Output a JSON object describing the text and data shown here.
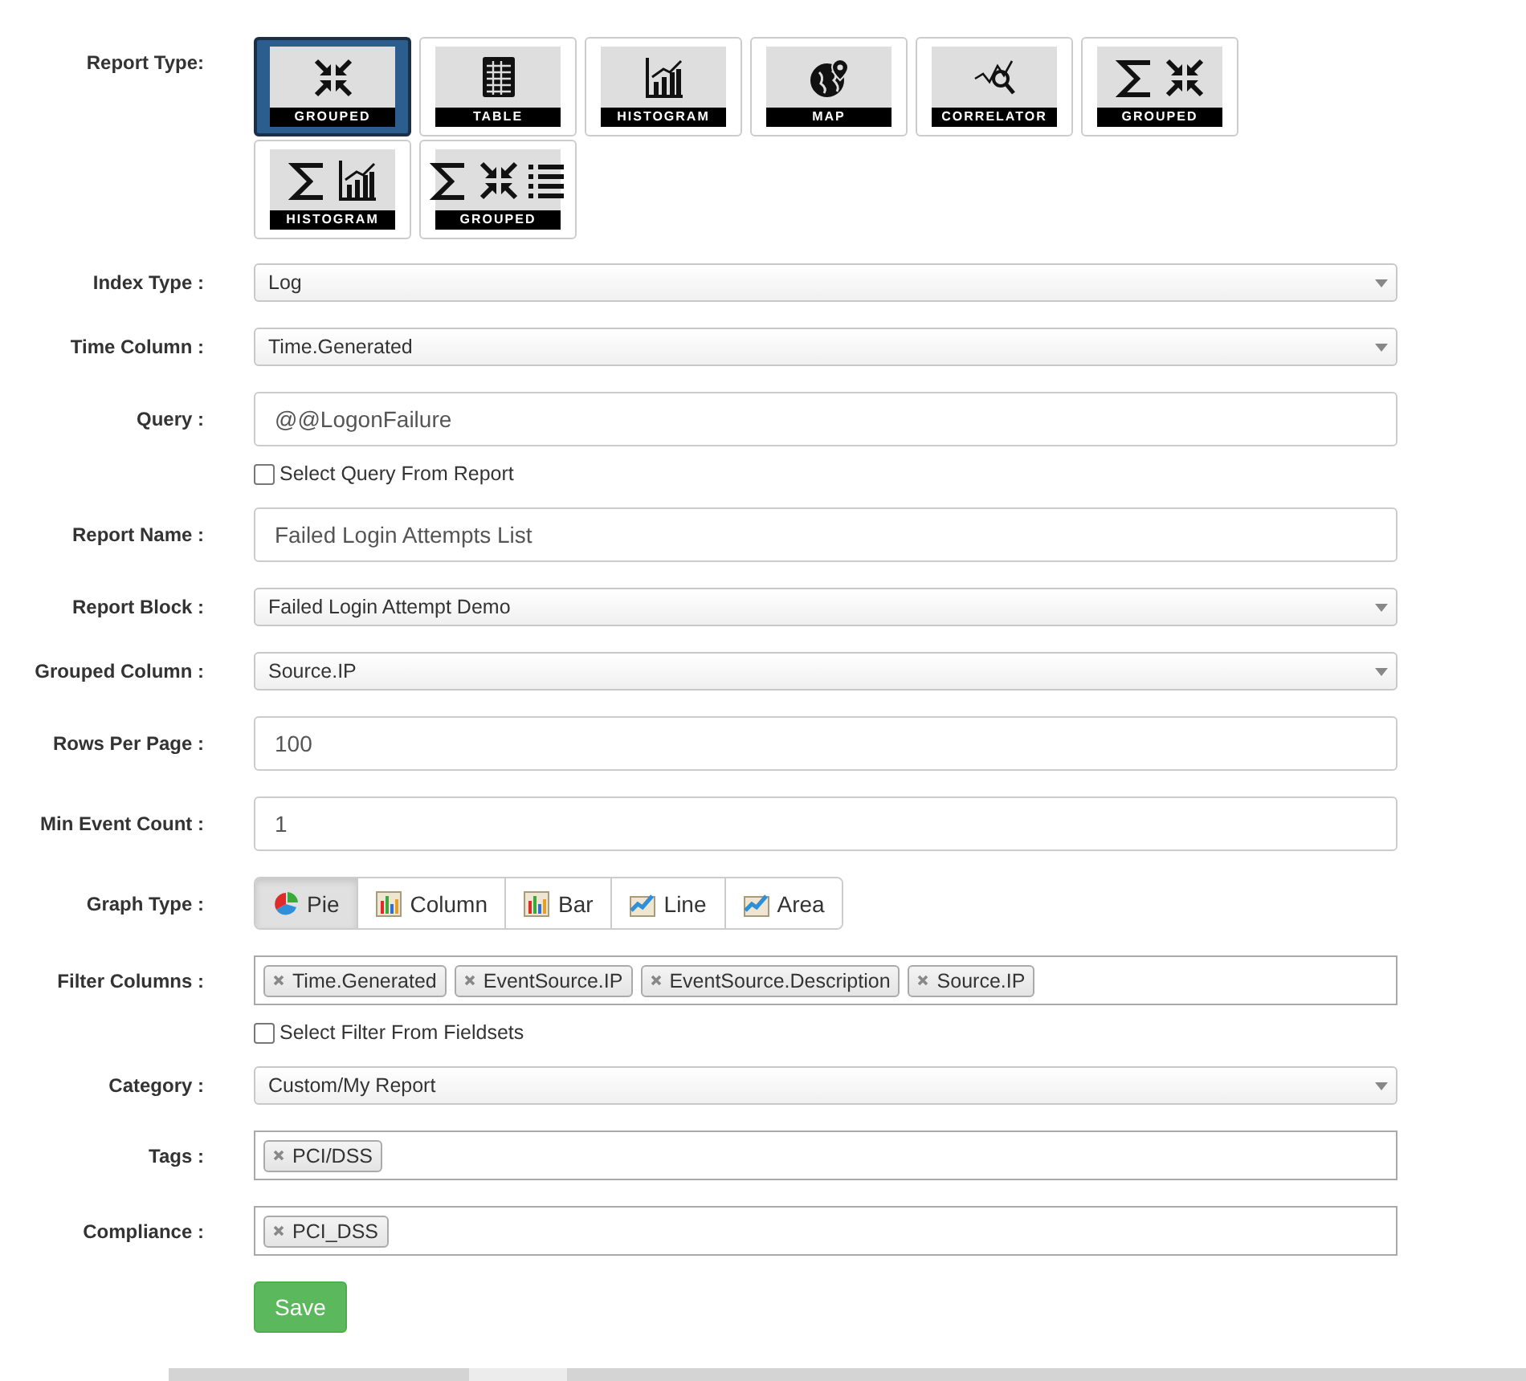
{
  "form": {
    "rows": [
      {
        "kind": "tiles",
        "label": "Report Type:",
        "tiles": [
          {
            "kind": "grouped",
            "label": "GROUPED",
            "selected": true
          },
          {
            "kind": "table",
            "label": "TABLE",
            "selected": false
          },
          {
            "kind": "histogram",
            "label": "HISTOGRAM",
            "selected": false
          },
          {
            "kind": "map",
            "label": "MAP",
            "selected": false
          },
          {
            "kind": "correlator",
            "label": "CORRELATOR",
            "selected": false
          },
          {
            "kind": "sumgrouped",
            "label": "GROUPED",
            "selected": false
          },
          {
            "kind": "sumhistogram",
            "label": "HISTOGRAM",
            "selected": false
          },
          {
            "kind": "sumgroupedlist",
            "label": "GROUPED",
            "selected": false
          }
        ]
      },
      {
        "kind": "select",
        "label": "Index Type :",
        "value": "Log"
      },
      {
        "kind": "select",
        "label": "Time Column :",
        "value": "Time.Generated"
      },
      {
        "kind": "input",
        "label": "Query :",
        "value": "@@LogonFailure"
      },
      {
        "kind": "checkbox",
        "text": "Select Query From Report",
        "checked": false
      },
      {
        "kind": "input",
        "label": "Report Name :",
        "value": "Failed Login Attempts List"
      },
      {
        "kind": "select",
        "label": "Report Block :",
        "value": "Failed Login Attempt Demo"
      },
      {
        "kind": "select",
        "label": "Grouped Column :",
        "value": "Source.IP"
      },
      {
        "kind": "input",
        "label": "Rows Per Page :",
        "value": "100"
      },
      {
        "kind": "input",
        "label": "Min Event Count :",
        "value": "1"
      },
      {
        "kind": "buttons",
        "label": "Graph Type :",
        "buttons": [
          {
            "kind": "pie",
            "label": "Pie",
            "selected": true
          },
          {
            "kind": "column",
            "label": "Column",
            "selected": false
          },
          {
            "kind": "bar",
            "label": "Bar",
            "selected": false
          },
          {
            "kind": "line",
            "label": "Line",
            "selected": false
          },
          {
            "kind": "area",
            "label": "Area",
            "selected": false
          }
        ]
      },
      {
        "kind": "tags",
        "label": "Filter Columns :",
        "tags": [
          "Time.Generated",
          "EventSource.IP",
          "EventSource.Description",
          "Source.IP"
        ]
      },
      {
        "kind": "checkbox",
        "text": "Select Filter From Fieldsets",
        "checked": false
      },
      {
        "kind": "select",
        "label": "Category :",
        "value": "Custom/My Report"
      },
      {
        "kind": "tags",
        "label": "Tags :",
        "tags": [
          "PCI/DSS"
        ]
      },
      {
        "kind": "tags",
        "label": "Compliance :",
        "tags": [
          "PCI_DSS"
        ]
      },
      {
        "kind": "submit",
        "text": "Save"
      }
    ]
  }
}
